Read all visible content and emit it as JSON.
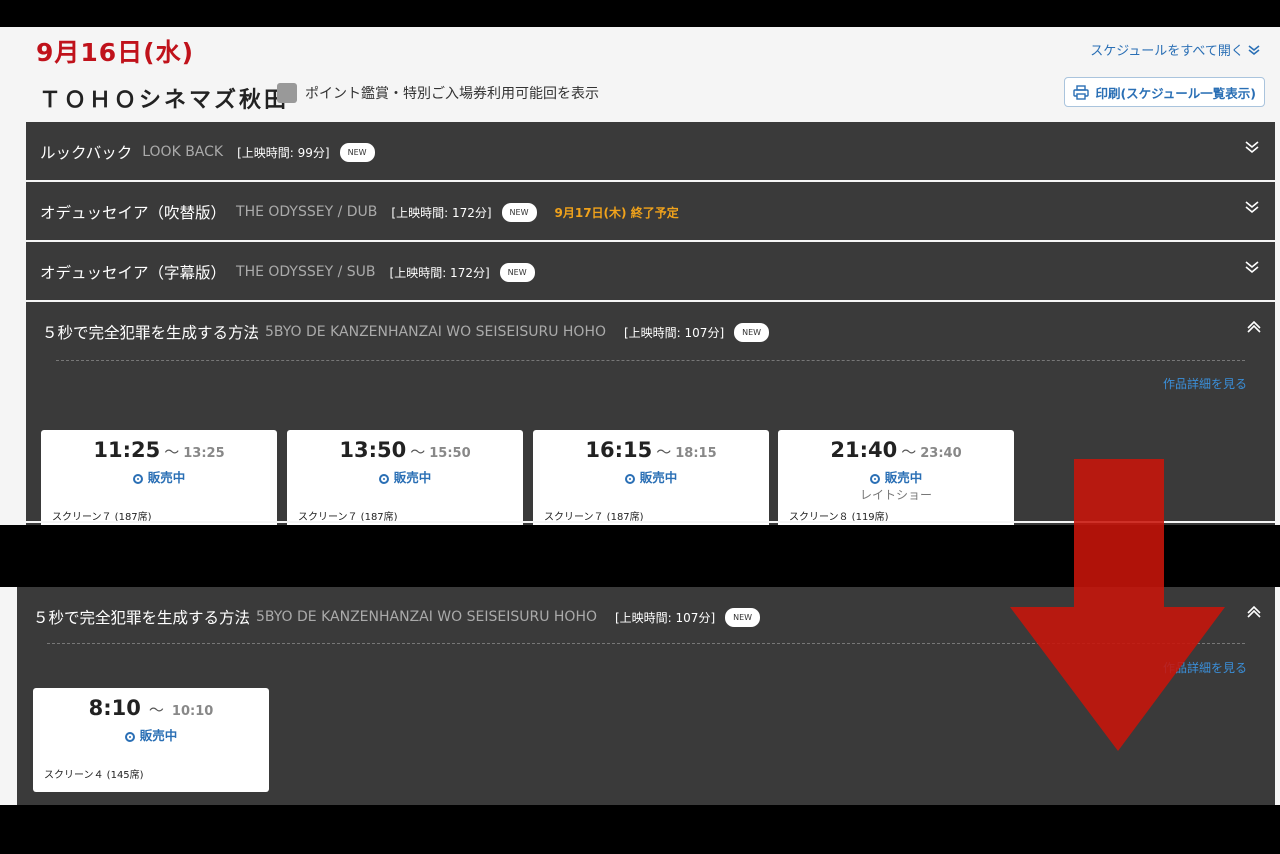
{
  "header": {
    "date": "9月16日(水)",
    "expand_all": "スケジュールをすべて開く",
    "theater": "ＴＯＨＯシネマズ秋田",
    "filter_label": "ポイント鑑賞・特別ご入場券利用可能回を表示",
    "print_label": "印刷(スケジュール一覧表示)"
  },
  "movies": [
    {
      "title_jp": "ルックバック",
      "title_en": "LOOK BACK",
      "runtime": "[上映時間: 99分]",
      "badge": "NEW"
    },
    {
      "title_jp": "オデュッセイア（吹替版）",
      "title_en": "THE ODYSSEY / DUB",
      "runtime": "[上映時間: 172分]",
      "badge": "NEW",
      "ending": "9月17日(木) 終了予定"
    },
    {
      "title_jp": "オデュッセイア（字幕版）",
      "title_en": "THE ODYSSEY / SUB",
      "runtime": "[上映時間: 172分]",
      "badge": "NEW"
    },
    {
      "title_jp": "５秒で完全犯罪を生成する方法",
      "title_en": "5BYO DE KANZENHANZAI WO SEISEISURU HOHO",
      "runtime": "[上映時間: 107分]",
      "badge": "NEW"
    }
  ],
  "detail_link": "作品詳細を見る",
  "showtimes_top": [
    {
      "start": "11:25",
      "tilde": "〜",
      "end": "13:25",
      "status": "販売中",
      "note": "",
      "screen": "スクリーン７ (187席)"
    },
    {
      "start": "13:50",
      "tilde": "〜",
      "end": "15:50",
      "status": "販売中",
      "note": "",
      "screen": "スクリーン７ (187席)"
    },
    {
      "start": "16:15",
      "tilde": "〜",
      "end": "18:15",
      "status": "販売中",
      "note": "",
      "screen": "スクリーン７ (187席)"
    },
    {
      "start": "21:40",
      "tilde": "〜",
      "end": "23:40",
      "status": "販売中",
      "note": "レイトショー",
      "screen": "スクリーン８ (119席)"
    }
  ],
  "bottom": {
    "title_jp": "５秒で完全犯罪を生成する方法",
    "title_en": "5BYO DE KANZENHANZAI WO SEISEISURU HOHO",
    "runtime": "[上映時間: 107分]",
    "badge": "NEW",
    "detail_link": "作品詳細を見る",
    "showtimes": [
      {
        "start": "8:10",
        "tilde": "〜",
        "end": "10:10",
        "status": "販売中",
        "screen": "スクリーン４ (145席)"
      }
    ]
  },
  "colors": {
    "date_red": "#c0121b",
    "link_blue": "#2a6fb5",
    "bar_dark": "#3a3a3a",
    "ending_orange": "#f0a21b",
    "arrow_red": "#c8140a"
  },
  "icons": [
    "chevron-double-down-icon",
    "chevron-up-icon",
    "printer-icon",
    "ring-icon",
    "red-down-arrow"
  ]
}
